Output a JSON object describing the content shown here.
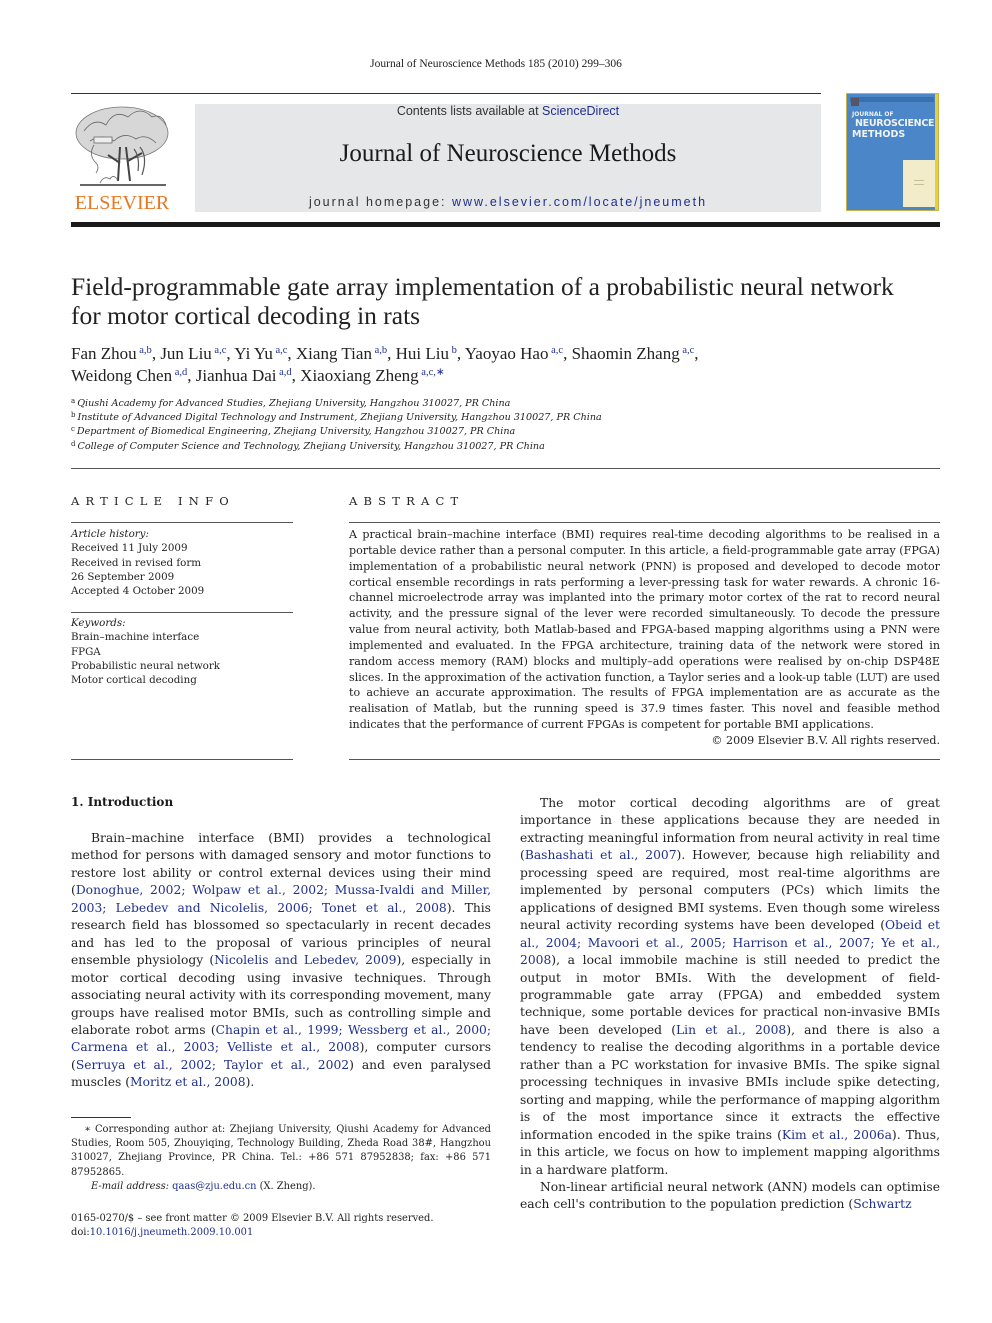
{
  "running_head": "Journal of Neuroscience Methods 185 (2010) 299–306",
  "publisher": {
    "logo_word": "ELSEVIER",
    "brand_color": "#e87722"
  },
  "masthead": {
    "contents_prefix": "Contents lists available at ",
    "contents_link": "ScienceDirect",
    "journal_title": "Journal of Neuroscience Methods",
    "homepage_prefix": "journal homepage: ",
    "homepage_link": "www.elsevier.com/locate/jneumeth",
    "background_color": "#e6e7e8",
    "link_color": "#1f2f8f"
  },
  "cover": {
    "line1": "JOURNAL OF",
    "line2": "NEUROSCIENCE",
    "line3": "METHODS",
    "color": "#4a86c8"
  },
  "article": {
    "title_line1": "Field-programmable gate array implementation of a probabilistic neural network",
    "title_line2": "for motor cortical decoding in rats",
    "authors": [
      {
        "name": "Fan Zhou",
        "sup": "a,b",
        "sep": ", "
      },
      {
        "name": "Jun Liu",
        "sup": "a,c",
        "sep": ", "
      },
      {
        "name": "Yi Yu",
        "sup": "a,c",
        "sep": ", "
      },
      {
        "name": "Xiang Tian",
        "sup": "a,b",
        "sep": ", "
      },
      {
        "name": "Hui Liu",
        "sup": "b",
        "sep": ", "
      },
      {
        "name": "Yaoyao Hao",
        "sup": "a,c",
        "sep": ", "
      },
      {
        "name": "Shaomin Zhang",
        "sup": "a,c",
        "sep": ","
      },
      {
        "name": "Weidong Chen",
        "sup": "a,d",
        "sep": ", "
      },
      {
        "name": "Jianhua Dai",
        "sup": "a,d",
        "sep": ", "
      },
      {
        "name": "Xiaoxiang Zheng",
        "sup": "a,c,∗",
        "sep": ""
      }
    ],
    "affiliations": [
      {
        "key": "a",
        "text": "Qiushi Academy for Advanced Studies, Zhejiang University, Hangzhou 310027, PR China"
      },
      {
        "key": "b",
        "text": "Institute of Advanced Digital Technology and Instrument, Zhejiang University, Hangzhou 310027, PR China"
      },
      {
        "key": "c",
        "text": "Department of Biomedical Engineering, Zhejiang University, Hangzhou 310027, PR China"
      },
      {
        "key": "d",
        "text": "College of Computer Science and Technology, Zhejiang University, Hangzhou 310027, PR China"
      }
    ]
  },
  "article_info": {
    "heading": "ARTICLE INFO",
    "history_label": "Article history:",
    "history": [
      "Received 11 July 2009",
      "Received in revised form",
      "26 September 2009",
      "Accepted 4 October 2009"
    ],
    "keywords_label": "Keywords:",
    "keywords": [
      "Brain–machine interface",
      "FPGA",
      "Probabilistic neural network",
      "Motor cortical decoding"
    ]
  },
  "abstract": {
    "heading": "ABSTRACT",
    "text": "A practical brain–machine interface (BMI) requires real-time decoding algorithms to be realised in a portable device rather than a personal computer. In this article, a field-programmable gate array (FPGA) implementation of a probabilistic neural network (PNN) is proposed and developed to decode motor cortical ensemble recordings in rats performing a lever-pressing task for water rewards. A chronic 16-channel microelectrode array was implanted into the primary motor cortex of the rat to record neural activity, and the pressure signal of the lever were recorded simultaneously. To decode the pressure value from neural activity, both Matlab-based and FPGA-based mapping algorithms using a PNN were implemented and evaluated. In the FPGA architecture, training data of the network were stored in random access memory (RAM) blocks and multiply–add operations were realised by on-chip DSP48E slices. In the approximation of the activation function, a Taylor series and a look-up table (LUT) are used to achieve an accurate approximation. The results of FPGA implementation are as accurate as the realisation of Matlab, but the running speed is 37.9 times faster. This novel and feasible method indicates that the performance of current FPGAs is competent for portable BMI applications.",
    "copyright": "© 2009 Elsevier B.V. All rights reserved."
  },
  "introduction": {
    "heading": "1.  Introduction",
    "left_paragraph": [
      {
        "t": "Brain–machine interface (BMI) provides a technological method for persons with damaged sensory and motor functions to restore lost ability or control external devices using their mind ("
      },
      {
        "l": "Donoghue, 2002; Wolpaw et al., 2002; Mussa-Ivaldi and Miller, 2003; Lebedev and Nicolelis, 2006; Tonet et al., 2008"
      },
      {
        "t": "). This research field has blossomed so spectacularly in recent decades and has led to the pro­posal of various principles of neural ensemble physiology ("
      },
      {
        "l": "Nicolelis and Lebedev, 2009"
      },
      {
        "t": "), especially in motor cortical decoding using invasive techniques. Through associating neural activity with its corresponding movement, many groups have realised motor BMIs, such as controlling simple and elaborate robot arms ("
      },
      {
        "l": "Chapin et al., 1999; Wessberg et al., 2000; Carmena et al., 2003; Velliste et al., 2008"
      },
      {
        "t": "), computer cursors ("
      },
      {
        "l": "Serruya et al., 2002; Taylor et al., 2002"
      },
      {
        "t": ") and even paralysed muscles ("
      },
      {
        "l": "Moritz et al., 2008"
      },
      {
        "t": ")."
      }
    ],
    "right_paragraph_1": [
      {
        "t": "The motor cortical decoding algorithms are of great importance in these applications because they are needed in extracting mean­ingful information from neural activity in real time ("
      },
      {
        "l": "Bashashati et al., 2007"
      },
      {
        "t": "). However, because high reliability and processing speed are required, most real-time algorithms are implemented by per­sonal computers (PCs) which limits the applications of designed BMI systems. Even though some wireless neural activity record­ing systems have been developed ("
      },
      {
        "l": "Obeid et al., 2004; Mavoori et al., 2005; Harrison et al., 2007; Ye et al., 2008"
      },
      {
        "t": "), a local immo­bile machine is still needed to predict the output in motor BMIs. With the development of field-programmable gate array (FPGA) and embedded system technique, some portable devices for prac­tical non-invasive BMIs have been developed ("
      },
      {
        "l": "Lin et al., 2008"
      },
      {
        "t": "), and there is also a tendency to realise the decoding algorithms in a portable device rather than a PC workstation for invasive BMIs. The spike signal processing techniques in invasive BMIs include spike detecting, sorting and mapping, while the performance of mapping algorithm is of the most importance since it extracts the effective information encoded in the spike trains ("
      },
      {
        "l": "Kim et al., 2006a"
      },
      {
        "t": "). Thus, in this article, we focus on how to implement mapping algorithms in a hardware platform."
      }
    ],
    "right_paragraph_2": [
      {
        "t": "Non-linear artificial neural network (ANN) models can optimise each cell's contribution to the population prediction ("
      },
      {
        "l": "Schwartz"
      }
    ]
  },
  "footnote": {
    "star": "∗",
    "text": "Corresponding author at: Zhejiang University, Qiushi Academy for Advanced Studies, Room 505, Zhouyiqing, Technology Building, Zheda Road 38#, Hangzhou 310027, Zhejiang Province, PR China. Tel.: +86 571 87952838; fax: +86 571 87952865.",
    "email_label": "E-mail address:",
    "email": "qaas@zju.edu.cn",
    "email_suffix": " (X. Zheng)."
  },
  "front_matter": {
    "issn_line": "0165-0270/$ – see front matter © 2009 Elsevier B.V. All rights reserved.",
    "doi_prefix": "doi:",
    "doi": "10.1016/j.jneumeth.2009.10.001"
  }
}
